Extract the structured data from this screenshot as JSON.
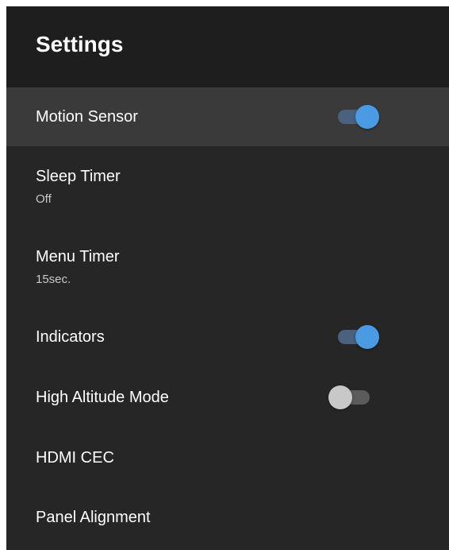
{
  "header": {
    "title": "Settings"
  },
  "items": [
    {
      "label": "Motion Sensor",
      "toggle": "on"
    },
    {
      "label": "Sleep Timer",
      "value": "Off"
    },
    {
      "label": "Menu Timer",
      "value": "15sec."
    },
    {
      "label": "Indicators",
      "toggle": "on"
    },
    {
      "label": "High Altitude Mode",
      "toggle": "off"
    },
    {
      "label": "HDMI CEC"
    },
    {
      "label": "Panel Alignment"
    }
  ],
  "colors": {
    "background": "#262626",
    "header_background": "#1e1e1e",
    "selected_row": "#3a3a3a",
    "toggle_on_knob": "#4a9be3",
    "toggle_on_track": "#4a6180",
    "toggle_off_knob": "#c8c8c8",
    "toggle_off_track": "#5b5b5b"
  }
}
